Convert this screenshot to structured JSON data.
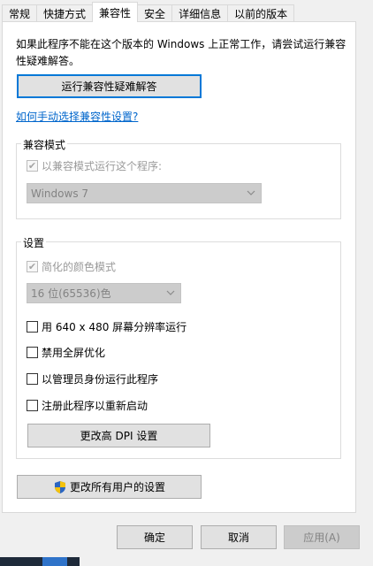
{
  "tabs": [
    {
      "label": "常规",
      "active": false
    },
    {
      "label": "快捷方式",
      "active": false
    },
    {
      "label": "兼容性",
      "active": true
    },
    {
      "label": "安全",
      "active": false
    },
    {
      "label": "详细信息",
      "active": false
    },
    {
      "label": "以前的版本",
      "active": false
    }
  ],
  "intro": {
    "text": "如果此程序不能在这个版本的 Windows 上正常工作，请尝试运行兼容性疑难解答。"
  },
  "troubleshoot_button": "运行兼容性疑难解答",
  "manual_link": "如何手动选择兼容性设置?",
  "compat_mode": {
    "title": "兼容模式",
    "checkbox_label": "以兼容模式运行这个程序:",
    "checked": true,
    "os_selected": "Windows 7"
  },
  "settings": {
    "title": "设置",
    "reduced_color": {
      "label": "简化的颜色模式",
      "checked": true
    },
    "color_selected": "16 位(65536)色",
    "options": [
      {
        "label": "用 640 x 480 屏幕分辨率运行",
        "checked": false
      },
      {
        "label": "禁用全屏优化",
        "checked": false
      },
      {
        "label": "以管理员身份运行此程序",
        "checked": false
      },
      {
        "label": "注册此程序以重新启动",
        "checked": false
      }
    ],
    "dpi_button": "更改高 DPI 设置"
  },
  "all_users_button": "更改所有用户的设置",
  "footer": {
    "ok": "确定",
    "cancel": "取消",
    "apply": "应用(A)"
  },
  "colors": {
    "accent": "#0078d7",
    "link": "#0066cc"
  }
}
